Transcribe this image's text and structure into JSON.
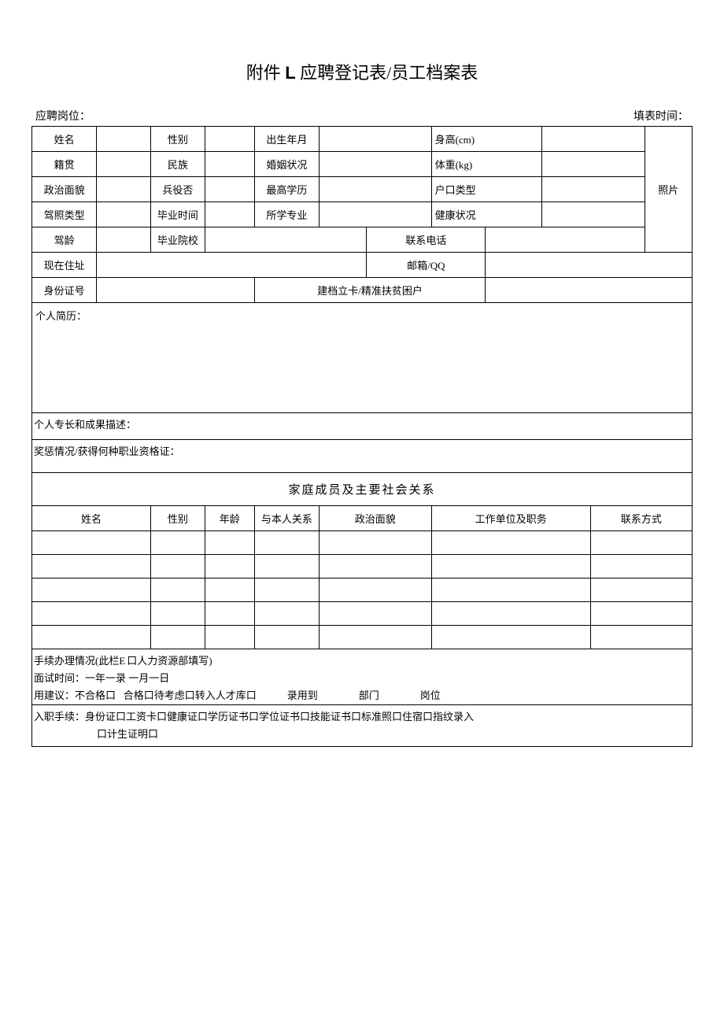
{
  "title_prefix": "附件 ",
  "title_L": "L",
  "title_suffix": " 应聘登记表/员工档案表",
  "header": {
    "position_label": "应聘岗位：",
    "fill_time_label": "填表时间："
  },
  "labels": {
    "name": "姓名",
    "gender": "性别",
    "birth": "出生年月",
    "height": "身高(cm)",
    "native": "籍贯",
    "ethnic": "民族",
    "marital": "婚姻状况",
    "weight": "体重(kg)",
    "politics": "政治面貌",
    "military": "兵役否",
    "edu": "最高学历",
    "hukou": "户口类型",
    "license": "驾照类型",
    "gradtime": "毕业时间",
    "major": "所学专业",
    "health": "健康状况",
    "drive_age": "驾龄",
    "school": "毕业院校",
    "phone": "联系电话",
    "address": "现在住址",
    "email": "邮箱/QQ",
    "idno": "身份证号",
    "poverty": "建档立卡/精准扶贫困户",
    "photo": "照片",
    "resume": "个人简历：",
    "specialty": "个人专长和成果描述：",
    "awards": "奖惩情况/获得何种职业资格证：",
    "family_head": "家庭成员及主要社会关系",
    "fam_name": "姓名",
    "fam_gender": "性别",
    "fam_age": "年龄",
    "fam_relation": "与本人关系",
    "fam_politics": "政治面貌",
    "fam_work": "工作单位及职务",
    "fam_contact": "联系方式"
  },
  "footer": {
    "line1a": "手续办理情况(此栏E",
    "line1b": "口人力资源部填写)",
    "line2a": "面试时间：一年一录",
    "line2b": "一月一日",
    "line3a": "用建议：不合格口",
    "line3b": "合格口待考虑口转入人才库口   录用到    部门    岗位",
    "line4": "入职手续：身份证口工资卡口健康证口学历证书口学位证书口技能证书口标准照口住宿口指纹录入",
    "line5": "口计生证明口"
  }
}
